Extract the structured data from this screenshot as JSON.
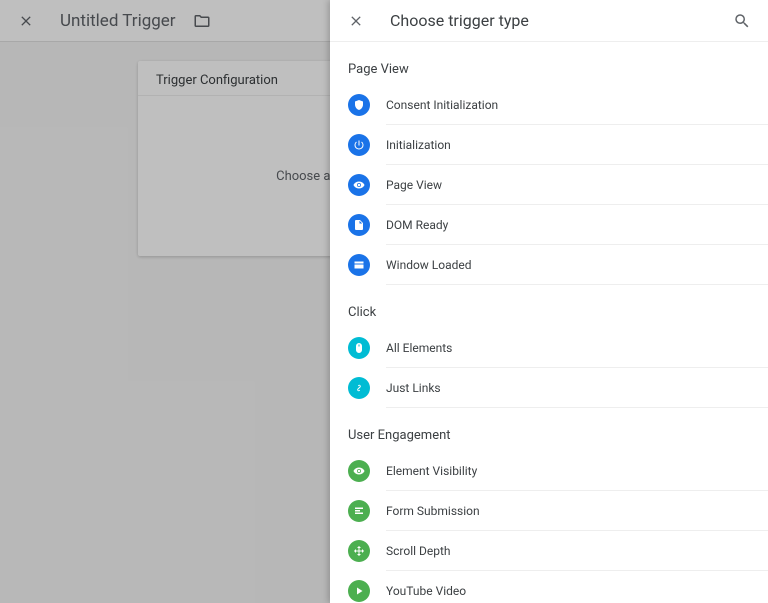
{
  "header": {
    "title": "Untitled Trigger"
  },
  "card": {
    "title": "Trigger Configuration",
    "placeholder": "Choose a trigger type to begin setup..."
  },
  "panel": {
    "title": "Choose trigger type",
    "sections": [
      {
        "label": "Page View",
        "items": [
          {
            "label": "Consent Initialization",
            "icon": "shield-icon",
            "color": "blue"
          },
          {
            "label": "Initialization",
            "icon": "power-icon",
            "color": "blue"
          },
          {
            "label": "Page View",
            "icon": "eye-icon",
            "color": "blue"
          },
          {
            "label": "DOM Ready",
            "icon": "document-icon",
            "color": "blue"
          },
          {
            "label": "Window Loaded",
            "icon": "window-icon",
            "color": "blue"
          }
        ]
      },
      {
        "label": "Click",
        "items": [
          {
            "label": "All Elements",
            "icon": "mouse-icon",
            "color": "cyan"
          },
          {
            "label": "Just Links",
            "icon": "link-icon",
            "color": "cyan"
          }
        ]
      },
      {
        "label": "User Engagement",
        "items": [
          {
            "label": "Element Visibility",
            "icon": "eye-icon",
            "color": "green"
          },
          {
            "label": "Form Submission",
            "icon": "form-icon",
            "color": "green"
          },
          {
            "label": "Scroll Depth",
            "icon": "scroll-icon",
            "color": "green"
          },
          {
            "label": "YouTube Video",
            "icon": "play-icon",
            "color": "green"
          }
        ]
      }
    ]
  }
}
